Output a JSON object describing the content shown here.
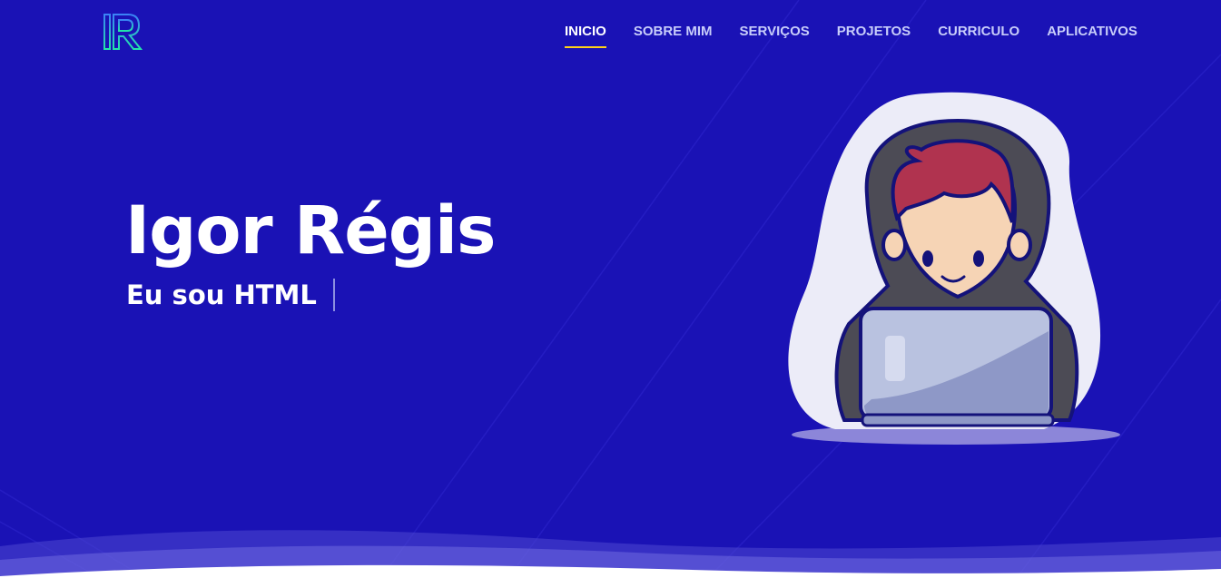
{
  "brand": {
    "logo_text": "IR"
  },
  "nav": {
    "items": [
      {
        "label": "INICIO",
        "active": true
      },
      {
        "label": "SOBRE MIM",
        "active": false
      },
      {
        "label": "SERVIÇOS",
        "active": false
      },
      {
        "label": "PROJETOS",
        "active": false
      },
      {
        "label": "CURRICULO",
        "active": false
      },
      {
        "label": "APLICATIVOS",
        "active": false
      }
    ]
  },
  "hero": {
    "title": "Igor Régis",
    "subtitle_prefix": "Eu sou ",
    "subtitle_typed": "HTML"
  },
  "colors": {
    "background": "#1a12b5",
    "accent_underline": "#ffd21a",
    "nav_text": "#c8cdfa",
    "logo_gradient": [
      "#3b82f6",
      "#22e6a8"
    ]
  },
  "illustration": {
    "icon": "hacker-with-laptop-illustration"
  }
}
